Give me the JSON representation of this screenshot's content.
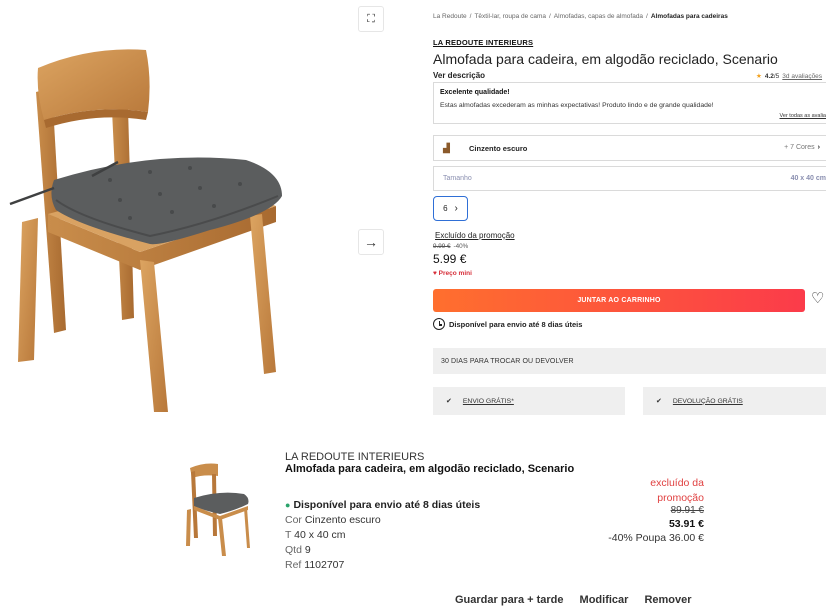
{
  "product": {
    "breadcrumbs": [
      "La Redoute",
      "Têxtil-lar, roupa de cama",
      "Almofadas, capas de almofada",
      "Almofadas para cadeiras"
    ],
    "brand": "LA REDOUTE INTERIEURS",
    "title": "Almofada para cadeira, em algodão reciclado, Scenario",
    "description_link": "Ver descrição",
    "rating": {
      "score": "4.2",
      "scale": "/5",
      "count": "3d avaliações"
    },
    "review": {
      "title": "Excelente qualidade!",
      "text": "Estas almofadas excederam as minhas expectativas! Produto lindo e de grande qualidade!",
      "see_all": "Ver todas as avalia"
    },
    "color": {
      "name": "Cinzento escuro",
      "more": "+ 7 Cores"
    },
    "size": {
      "label": "Tamanho",
      "value": "40 x 40 cm"
    },
    "quantity": "6",
    "promo_excluded": "Excluído da promoção",
    "old_price": "9.99 €",
    "discount": "-40%",
    "price": "5.99 €",
    "mini_price": "Preço mini",
    "add_to_cart": "JUNTAR AO CARRINHO",
    "availability": "Disponível para envio até 8 dias úteis",
    "returns": "30 DIAS PARA TROCAR OU DEVOLVER",
    "perks": [
      "ENVIO GRÁTIS*",
      "DEVOLUÇÃO GRÁTIS"
    ]
  },
  "basket_item": {
    "brand": "LA REDOUTE INTERIEURS",
    "title": "Almofada para cadeira, em algodão reciclado, Scenario",
    "availability": "Disponível para envio até 8 dias úteis",
    "color_label": "Cor",
    "color_value": "Cinzento escuro",
    "size_label": "T",
    "size_value": "40 x 40 cm",
    "qty_label": "Qtd",
    "qty_value": "9",
    "ref_label": "Ref",
    "ref_value": "1102707",
    "promo_excluded": "excluído da promoção",
    "old_price": "89.91 €",
    "price": "53.91 €",
    "saving": "-40% Poupa 36.00 €",
    "actions": [
      "Guardar para + tarde",
      "Modificar",
      "Remover"
    ]
  },
  "colors": {
    "cart_start": "#ff6f2e",
    "cart_end": "#fb3b4a",
    "selected_border": "#2f6fd6",
    "mini_price": "#d62d38",
    "promo_text": "#e04040",
    "stock_dot": "#2aa36b"
  }
}
